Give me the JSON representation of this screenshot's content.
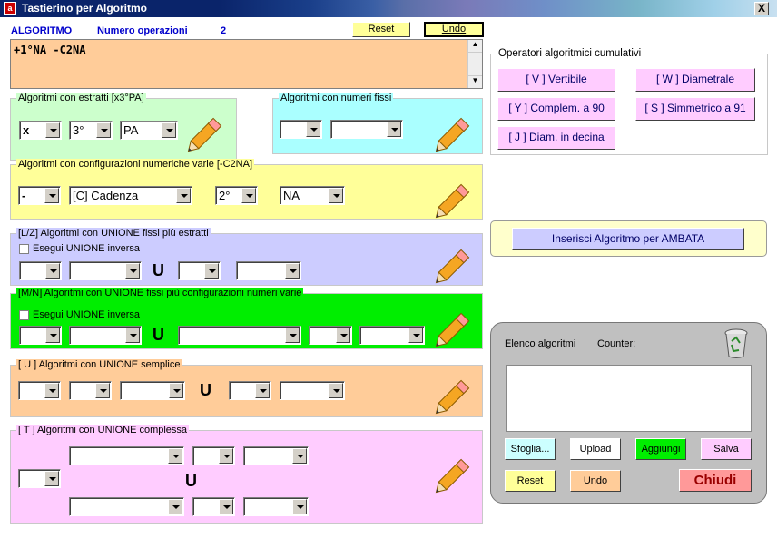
{
  "window": {
    "title": "Tastierino per Algoritmo",
    "close": "X"
  },
  "header": {
    "algoritmo_label": "ALGORITMO",
    "numero_label": "Numero operazioni",
    "numero_value": "2",
    "reset": "Reset",
    "undo": "Undo"
  },
  "expression": "+1°NA -C2NA",
  "g1": {
    "legend": "Algoritmi con estratti  [x3°PA]",
    "s1": "x",
    "s2": "3°",
    "s3": "PA"
  },
  "g2": {
    "legend": "Algoritmi con numeri fissi",
    "s1": "",
    "s2": ""
  },
  "g3": {
    "legend": "Algoritmi con configurazioni numeriche varie  [-C2NA]",
    "s1": "-",
    "s2": "[C] Cadenza",
    "s3": "2°",
    "s4": "NA"
  },
  "g4": {
    "legend": "[L/Z] Algoritmi con UNIONE fissi più estratti",
    "check": "Esegui UNIONE inversa",
    "u": "U"
  },
  "g5": {
    "legend": "[M/N] Algoritmi con UNIONE fissi più configurazioni numeri varie",
    "check": "Esegui UNIONE inversa",
    "u": "U"
  },
  "g6": {
    "legend": "[ U ] Algoritmi con UNIONE semplice",
    "u": "U"
  },
  "g7": {
    "legend": "[ T ] Algoritmi con UNIONE complessa",
    "u": "U"
  },
  "operators": {
    "legend": "Operatori algoritmici cumulativi",
    "v": "[ V ] Vertibile",
    "w": "[ W ] Diametrale",
    "y": "[ Y ] Complem. a 90",
    "s": "[ S ] Simmetrico  a 91",
    "j": "[ J ] Diam. in decina"
  },
  "insert": "Inserisci Algoritmo per AMBATA",
  "list": {
    "elenco": "Elenco algoritmi",
    "counter": "Counter:",
    "sfoglia": "Sfoglia...",
    "upload": "Upload",
    "aggiungi": "Aggiungi",
    "salva": "Salva",
    "reset": "Reset",
    "undo": "Undo",
    "chiudi": "Chiudi"
  },
  "colors": {
    "green": "#00ee00",
    "cyan": "#aaffff",
    "yellow": "#ffff99",
    "lavender": "#ccccff",
    "peach": "#ffcc99",
    "pink": "#ffccff"
  }
}
